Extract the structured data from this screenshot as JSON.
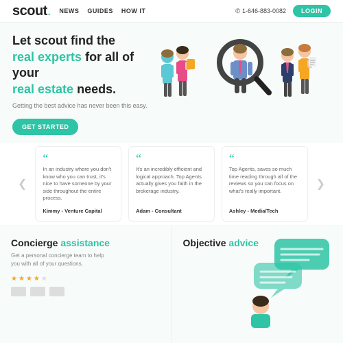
{
  "header": {
    "logo": "scout",
    "logo_dot": ".",
    "nav": [
      {
        "label": "NEWS"
      },
      {
        "label": "GUIDES"
      },
      {
        "label": "HOW IT"
      }
    ],
    "phone": "✆ 1-646-883-0082",
    "login_label": "LOGIN"
  },
  "hero": {
    "title_part1": "Let scout find the",
    "title_accent1": "real experts",
    "title_part2": "for all of your",
    "title_accent2": "real estate",
    "title_part3": "needs.",
    "subtitle": "Getting the best advice has never been this easy.",
    "cta_label": "GET STARTED"
  },
  "testimonials": {
    "arrow_left": "❮",
    "arrow_right": "❯",
    "cards": [
      {
        "quote": "“",
        "text": "In an industry where you don't know who you can trust, it's nice to have someone by your side throughout the entire process.",
        "author": "Kimmy - Venture Capital"
      },
      {
        "quote": "“",
        "text": "It's an incredibly efficient and logical approach. Top Agents actually gives you faith in the brokerage industry.",
        "author": "Adam - Consultant"
      },
      {
        "quote": "“",
        "text": "Top Agents, saves so much time reading through all of the reviews so you can focus on what's really important.",
        "author": "Ashley - Media/Tech"
      }
    ]
  },
  "bottom": {
    "left": {
      "title1": "Concierge",
      "title_accent": "assistance",
      "desc": "Get a personal concierge team to help you with all of your questions.",
      "stars": [
        true,
        true,
        true,
        true,
        false
      ]
    },
    "right": {
      "title1": "Objective",
      "title_accent": "advice"
    }
  }
}
